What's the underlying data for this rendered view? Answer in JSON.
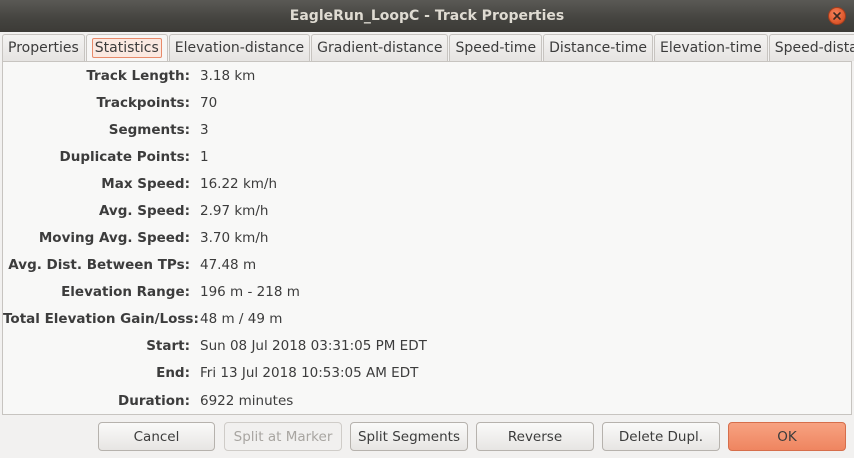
{
  "window": {
    "title": "EagleRun_LoopC - Track Properties"
  },
  "tabs": [
    {
      "label": "Properties"
    },
    {
      "label": "Statistics"
    },
    {
      "label": "Elevation-distance"
    },
    {
      "label": "Gradient-distance"
    },
    {
      "label": "Speed-time"
    },
    {
      "label": "Distance-time"
    },
    {
      "label": "Elevation-time"
    },
    {
      "label": "Speed-distance"
    }
  ],
  "active_tab": "Statistics",
  "stats": [
    {
      "label": "Track Length:",
      "value": "3.18 km"
    },
    {
      "label": "Trackpoints:",
      "value": "70"
    },
    {
      "label": "Segments:",
      "value": "3"
    },
    {
      "label": "Duplicate Points:",
      "value": "1"
    },
    {
      "label": "Max Speed:",
      "value": "16.22 km/h"
    },
    {
      "label": "Avg. Speed:",
      "value": "2.97 km/h"
    },
    {
      "label": "Moving Avg. Speed:",
      "value": "3.70 km/h"
    },
    {
      "label": "Avg. Dist. Between TPs:",
      "value": "47.48 m"
    },
    {
      "label": "Elevation Range:",
      "value": "196 m - 218 m"
    },
    {
      "label": "Total Elevation Gain/Loss:",
      "value": "48 m / 49 m"
    },
    {
      "label": "Start:",
      "value": "Sun 08 Jul 2018 03:31:05 PM EDT"
    },
    {
      "label": "End:",
      "value": "Fri 13 Jul 2018 10:53:05 AM EDT"
    },
    {
      "label": "Duration:",
      "value": "6922 minutes"
    }
  ],
  "buttons": {
    "cancel": "Cancel",
    "split_at_marker": "Split at Marker",
    "split_segments": "Split Segments",
    "reverse": "Reverse",
    "delete_dupl": "Delete Dupl.",
    "ok": "OK"
  },
  "colors": {
    "accent": "#ef8560",
    "titlebar": "#3c3b37"
  }
}
